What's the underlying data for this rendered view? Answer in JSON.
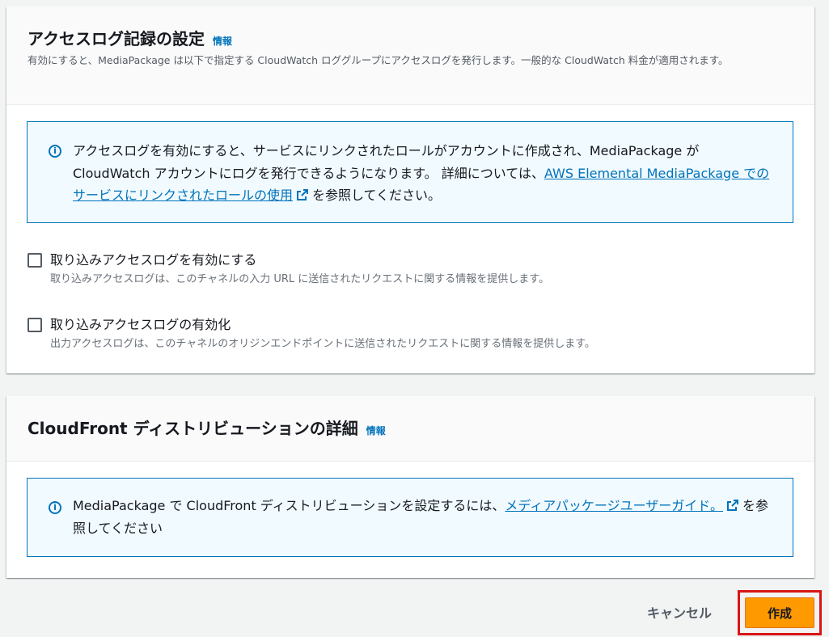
{
  "logging": {
    "title": "アクセスログ記録の設定",
    "info": "情報",
    "description": "有効にすると、MediaPackage は以下で指定する CloudWatch ロググループにアクセスログを発行します。一般的な CloudWatch 料金が適用されます。",
    "alert": {
      "text_before": "アクセスログを有効にすると、サービスにリンクされたロールがアカウントに作成され、MediaPackage が CloudWatch アカウントにログを発行できるようになります。 詳細については、",
      "link": "AWS Elemental MediaPackage でのサービスにリンクされたロールの使用",
      "text_after": "を参照してください。"
    },
    "ingest": {
      "label": "取り込みアクセスログを有効にする",
      "description": "取り込みアクセスログは、このチャネルの入力 URL に送信されたリクエストに関する情報を提供します。",
      "checked": false
    },
    "egress": {
      "label": "取り込みアクセスログの有効化",
      "description": "出力アクセスログは、このチャネルのオリジンエンドポイントに送信されたリクエストに関する情報を提供します。",
      "checked": false
    }
  },
  "cloudfront": {
    "title": "CloudFront ディストリビューションの詳細",
    "info": "情報",
    "alert": {
      "text_before": "MediaPackage で CloudFront ディストリビューションを設定するには、",
      "link": "メディアパッケージユーザーガイド。",
      "text_after": "を参照してください"
    }
  },
  "actions": {
    "cancel": "キャンセル",
    "create": "作成"
  },
  "colors": {
    "accent": "#0073bb",
    "primary_button": "#ff9900",
    "highlight": "#d91515"
  }
}
